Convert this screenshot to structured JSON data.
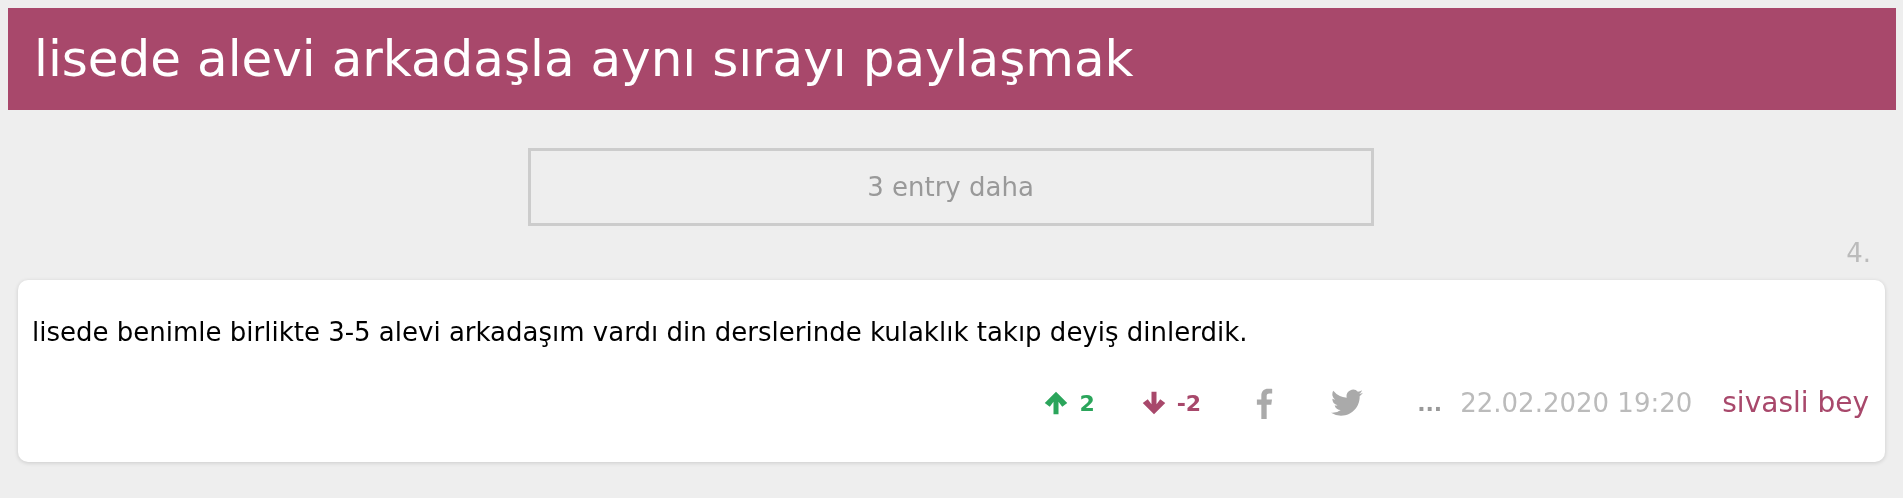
{
  "title": "lisede alevi arkadaşla aynı sırayı paylaşmak",
  "more_button": "3 entry daha",
  "entry": {
    "number": "4.",
    "text": "lisede benimle birlikte 3-5 alevi arkadaşım vardı din derslerinde kulaklık takıp deyiş dinlerdik.",
    "upvotes": "2",
    "downvotes": "-2",
    "more": "...",
    "date": "22.02.2020 19:20",
    "author": "sivasli bey"
  }
}
